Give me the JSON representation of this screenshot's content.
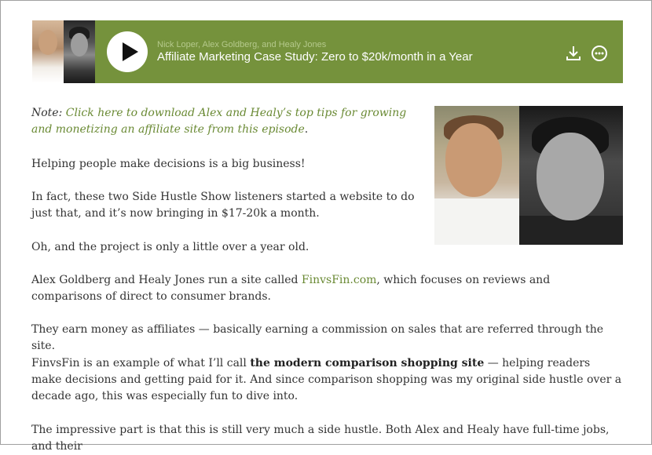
{
  "player": {
    "authors": "Nick Loper, Alex Goldberg, and Healy Jones",
    "title": "Affiliate Marketing Case Study: Zero to $20k/month in a Year",
    "accent_color": "#75923c",
    "icons": [
      "play-icon",
      "download-icon",
      "more-options-icon"
    ]
  },
  "article": {
    "note_label": "Note:",
    "note_link": "Click here to download Alex and Healy’s top tips for growing and monetizing an affiliate site from this episode",
    "note_end": ".",
    "p1": "Helping people make decisions is a big business!",
    "p2": "In fact, these two Side Hustle Show listeners started a website to do just that, and it’s now bringing in $17-20k a month.",
    "p3": "Oh, and the project is only a little over a year old.",
    "p4_a": "Alex Goldberg and Healy Jones run a site called ",
    "p4_link": "FinvsFin.com",
    "p4_b": ", which focuses on reviews and comparisons of direct to consumer brands.",
    "p5": "They earn money as affiliates — basically earning a commission on sales that are referred through the site.",
    "p6_a": "FinvsFin is an example of what I’ll call ",
    "p6_bold": "the modern comparison shopping site",
    "p6_b": " — helping readers make decisions and getting paid for it. And since comparison shopping was my original side hustle over a decade ago, this was especially fun to dive into.",
    "p7": "The impressive part is that this is still very much a side hustle. Both Alex and Healy have full-time jobs, and their",
    "link_color": "#6a8a34"
  }
}
